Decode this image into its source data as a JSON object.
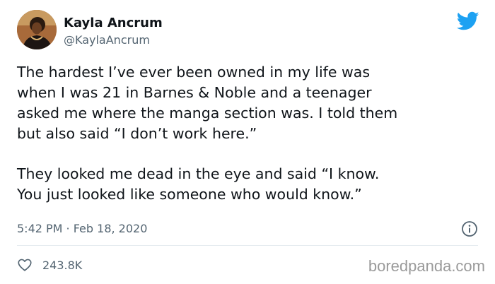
{
  "author": {
    "display_name": "Kayla Ancrum",
    "handle": "@KaylaAncrum",
    "avatar_icon": "profile-photo"
  },
  "platform_icon": "twitter-bird-icon",
  "tweet": {
    "lines": [
      "The hardest I’ve ever been owned in my life was",
      "when I was 21 in Barnes & Noble and a teenager",
      "asked me where the manga section was. I told them",
      "but also said “I don’t work here.”",
      "They looked me dead in the eye and said  “I know.",
      "You just looked like someone who would know.”"
    ],
    "timestamp": "5:42 PM · Feb 18, 2020"
  },
  "engagement": {
    "likes": "243.8K",
    "like_icon": "heart-icon",
    "info_icon": "info-icon"
  },
  "watermark": "boredpanda.com",
  "colors": {
    "accent": "#1da1f2",
    "secondary_text": "#536471",
    "primary_text": "#0f1419"
  }
}
